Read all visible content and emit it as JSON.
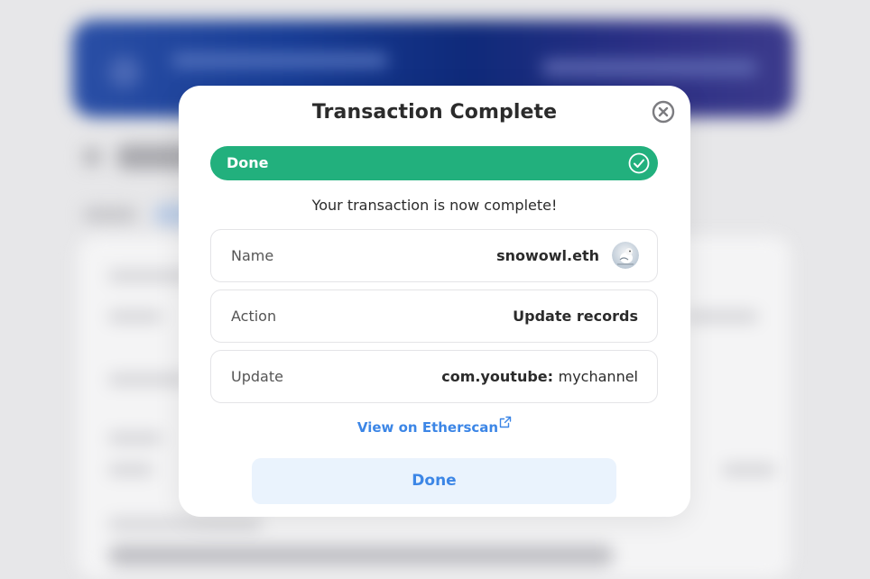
{
  "modal": {
    "title": "Transaction Complete",
    "progress_label": "Done",
    "message": "Your transaction is now complete!",
    "rows": [
      {
        "label": "Name",
        "value": "snowowl.eth"
      },
      {
        "label": "Action",
        "value": "Update records"
      },
      {
        "label": "Update",
        "value_key": "com.youtube:",
        "value_text": "mychannel"
      }
    ],
    "etherscan_link": "View on Etherscan",
    "done_button": "Done"
  },
  "colors": {
    "success": "#22b07d",
    "link": "#3c86e6",
    "done_bg": "#eaf3fd"
  },
  "icons": {
    "close": "close-circle-icon",
    "check": "check-circle-icon",
    "external": "external-link-icon"
  }
}
